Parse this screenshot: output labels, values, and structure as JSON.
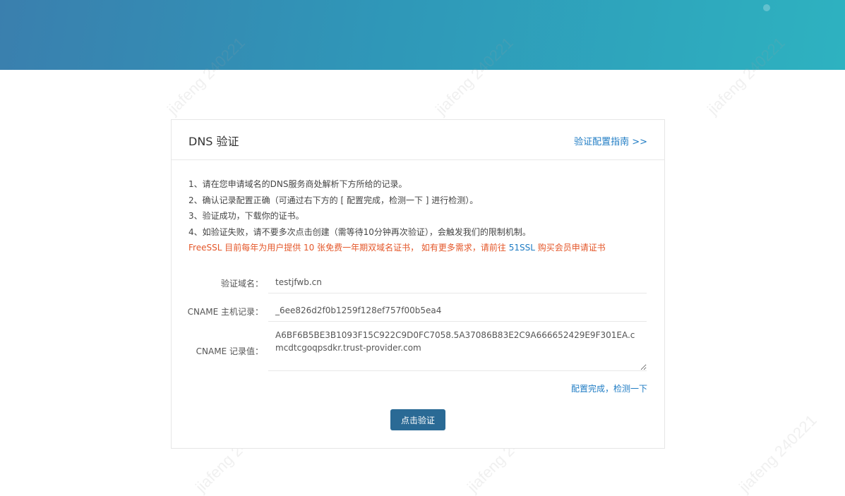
{
  "watermark": "jiafeng 240221",
  "card": {
    "title": "DNS 验证",
    "guide_link": "验证配置指南 >>"
  },
  "instructions": [
    "1、请在您申请域名的DNS服务商处解析下方所给的记录。",
    "2、确认记录配置正确（可通过右下方的 [ 配置完成，检测一下 ] 进行检测）。",
    "3、验证成功，下载你的证书。",
    "4、如验证失败，请不要多次点击创建（需等待10分钟再次验证），会触发我们的限制机制。"
  ],
  "notice": {
    "before": "FreeSSL 目前每年为用户提供 10 张免费一年期双域名证书， 如有更多需求，请前往 ",
    "link": "51SSL",
    "after": " 购买会员申请证书"
  },
  "form": {
    "domain_label": "验证域名：",
    "domain_value": "testjfwb.cn",
    "host_label": "CNAME 主机记录：",
    "host_value": "_6ee826d2f0b1259f128ef757f00b5ea4",
    "value_label": "CNAME 记录值：",
    "value_value": "A6BF6B5BE3B1093F15C922C9D0FC7058.5A37086B83E2C9A666652429E9F301EA.cmcdtcgoqpsdkr.trust-provider.com"
  },
  "check_link": "配置完成，检测一下",
  "verify_button": "点击验证"
}
